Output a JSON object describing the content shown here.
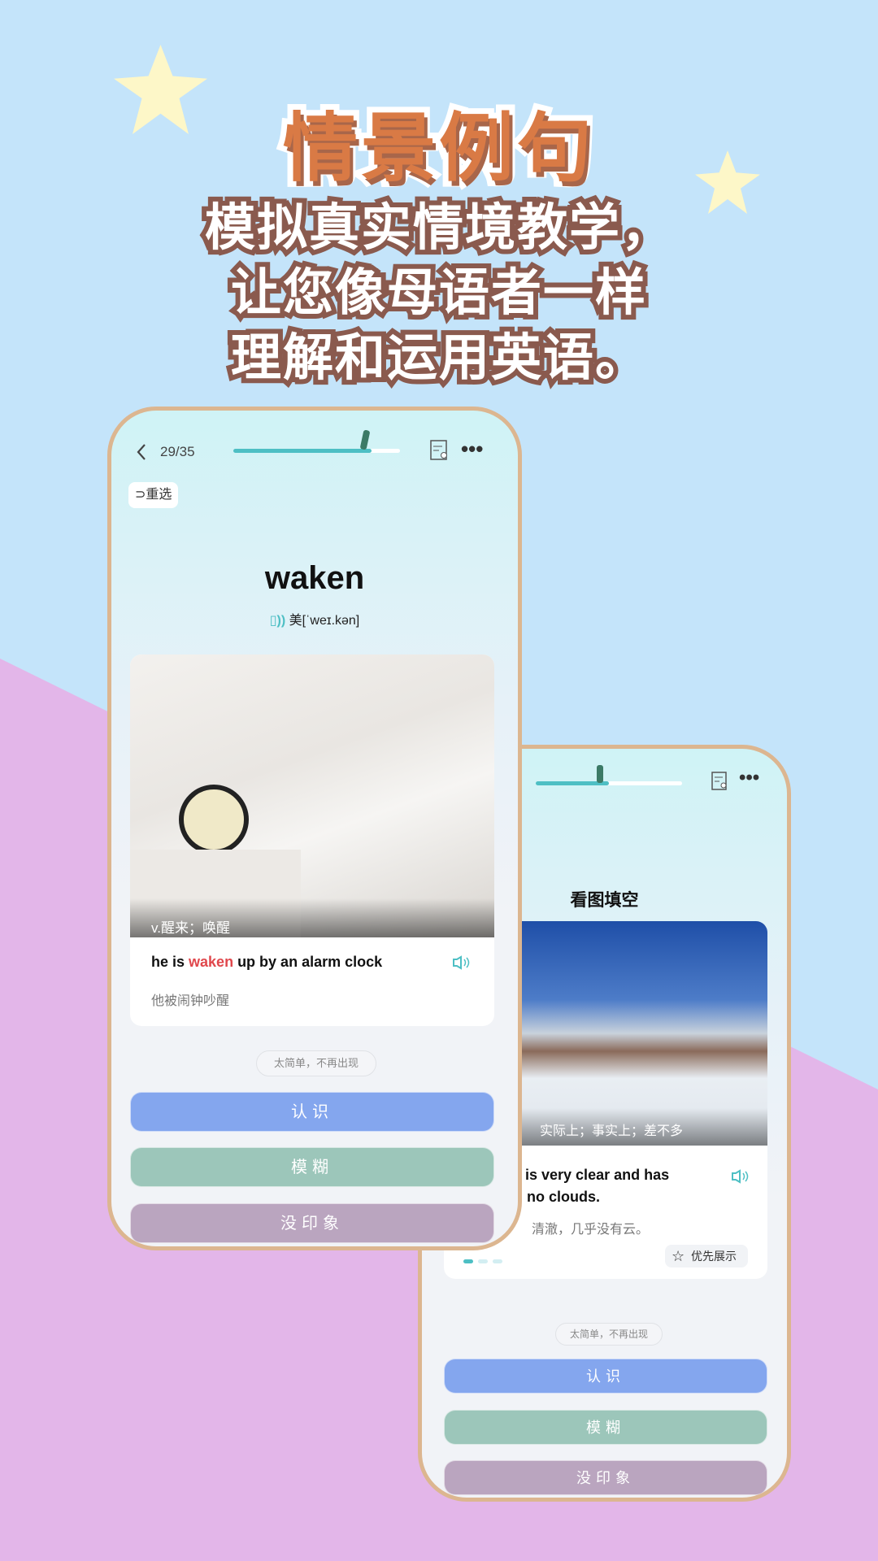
{
  "banner": {
    "title": "情景例句",
    "subtitle_lines": [
      "模拟真实情境教学，",
      "让您像母语者一样",
      "理解和运用英语。"
    ]
  },
  "front": {
    "progress_text": "29/35",
    "progress": 0.829,
    "reselect": "重选",
    "word": "waken",
    "phonetic": "美[ˈweɪ.kən]",
    "image_caption": "v.醒来；唤醒",
    "sentence_pre": "he is ",
    "sentence_hl": "waken",
    "sentence_post": " up by an alarm clock",
    "translation": "他被闹钟吵醒",
    "too_easy": "太简单，不再出现",
    "buttons": [
      "认识",
      "模糊",
      "没印象"
    ]
  },
  "back": {
    "progress": 0.5,
    "mode_title": "看图填空",
    "image_caption": "实际上；事实上；差不多",
    "sentence_line1": "is very clear and has",
    "sentence_line2": "no clouds.",
    "translation": "清澈，几乎没有云。",
    "priority": "优先展示",
    "too_easy": "太简单，不再出现",
    "buttons": [
      "认识",
      "模糊",
      "没印象"
    ]
  },
  "colors": {
    "accent": "#4dbfc4",
    "highlight": "#e0474c",
    "know": "#84a6ee",
    "vague": "#9cc6ba",
    "unknown": "#baa5bf"
  }
}
